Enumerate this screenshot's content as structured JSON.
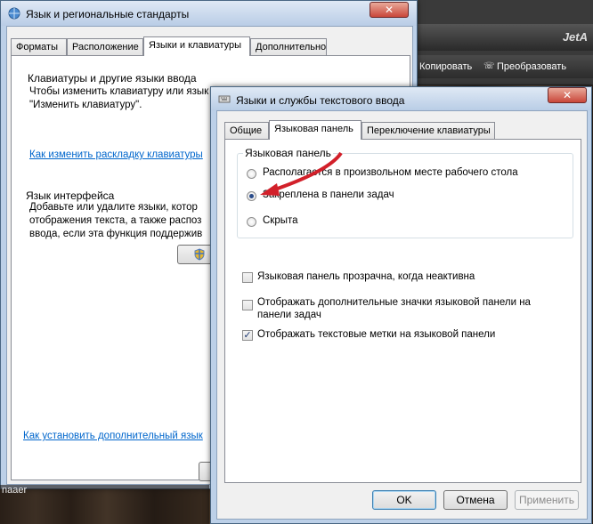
{
  "bg_app": {
    "brand": "JetA",
    "copy_label": "Копировать",
    "convert_label": "Преобразовать"
  },
  "main_window": {
    "title": "Язык и региональные стандарты",
    "close": "✕",
    "tabs": [
      "Форматы",
      "Расположение",
      "Языки и клавиатуры",
      "Дополнительно"
    ],
    "keyboards_group": {
      "label": "Клавиатуры и другие языки ввода",
      "text1": "Чтобы изменить клавиатуру или язык ввода текста, нажмите кнопку",
      "text2": "\"Изменить клавиатуру\".",
      "link": "Как изменить раскладку клавиатуры"
    },
    "interface_group": {
      "label": "Язык интерфейса",
      "text1": "Добавьте или удалите языки, котор",
      "text2": "отображения текста, а также распоз",
      "text3": "ввода, если эта функция поддержив"
    },
    "install_link": "Как установить дополнительный язык",
    "taskbar_text": "naaer"
  },
  "dialog": {
    "title": "Языки и службы текстового ввода",
    "close": "✕",
    "tabs": [
      "Общие",
      "Языковая панель",
      "Переключение клавиатуры"
    ],
    "group_label": "Языковая панель",
    "radios": [
      {
        "label": "Располагается в произвольном месте рабочего стола",
        "checked": false
      },
      {
        "label": "Закреплена в панели задач",
        "checked": true
      },
      {
        "label": "Скрыта",
        "checked": false
      }
    ],
    "checkboxes": [
      {
        "label": "Языковая панель прозрачна, когда неактивна",
        "checked": false
      },
      {
        "label": "Отображать дополнительные значки языковой панели на",
        "label2": "панели задач",
        "checked": false
      },
      {
        "label": "Отображать текстовые метки на языковой панели",
        "checked": true
      }
    ],
    "buttons": {
      "ok": "OK",
      "cancel": "Отмена",
      "apply": "Применить"
    }
  },
  "colors": {
    "arrow": "#d2202a",
    "link": "#0066cc"
  }
}
